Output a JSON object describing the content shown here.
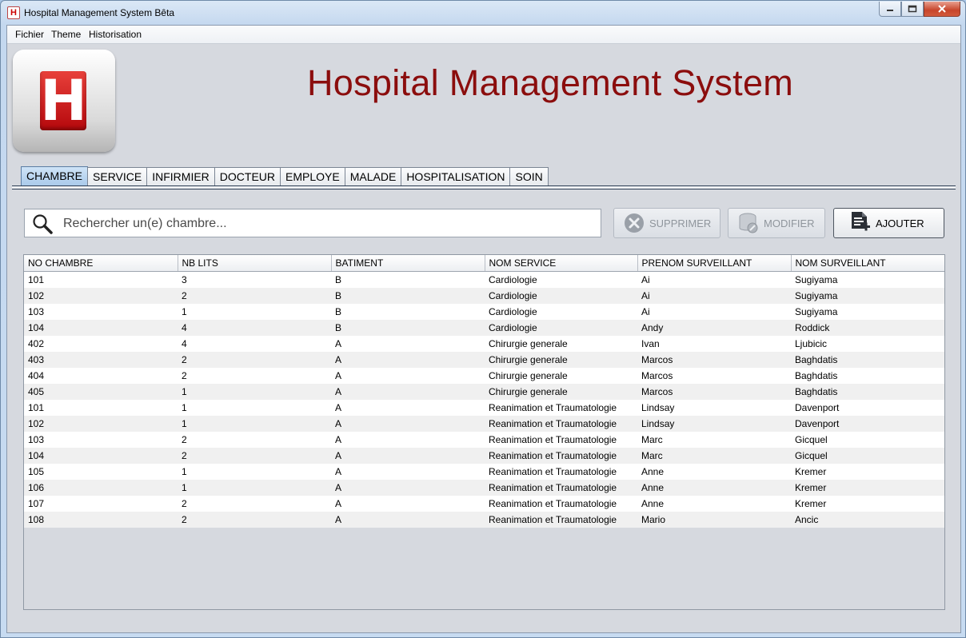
{
  "window": {
    "title": "Hospital Management System Bêta",
    "app_icon_letter": "H"
  },
  "menu": {
    "items": [
      "Fichier",
      "Theme",
      "Historisation"
    ]
  },
  "logo": {
    "letter": "H"
  },
  "header": {
    "title": "Hospital Management System",
    "title_color": "#8b0d0d"
  },
  "tabs": [
    "CHAMBRE",
    "SERVICE",
    "INFIRMIER",
    "DOCTEUR",
    "EMPLOYE",
    "MALADE",
    "HOSPITALISATION",
    "SOIN"
  ],
  "active_tab": "CHAMBRE",
  "search": {
    "placeholder": "Rechercher un(e) chambre...",
    "value": ""
  },
  "actions": {
    "delete_label": "SUPPRIMER",
    "edit_label": "MODIFIER",
    "add_label": "AJOUTER",
    "delete_enabled": false,
    "edit_enabled": false
  },
  "table": {
    "columns": [
      "NO CHAMBRE",
      "NB LITS",
      "BATIMENT",
      "NOM SERVICE",
      "PRENOM SURVEILLANT",
      "NOM SURVEILLANT"
    ],
    "rows": [
      [
        "101",
        "3",
        "B",
        "Cardiologie",
        "Ai",
        "Sugiyama"
      ],
      [
        "102",
        "2",
        "B",
        "Cardiologie",
        "Ai",
        "Sugiyama"
      ],
      [
        "103",
        "1",
        "B",
        "Cardiologie",
        "Ai",
        "Sugiyama"
      ],
      [
        "104",
        "4",
        "B",
        "Cardiologie",
        "Andy",
        "Roddick"
      ],
      [
        "402",
        "4",
        "A",
        "Chirurgie generale",
        "Ivan",
        "Ljubicic"
      ],
      [
        "403",
        "2",
        "A",
        "Chirurgie generale",
        "Marcos",
        "Baghdatis"
      ],
      [
        "404",
        "2",
        "A",
        "Chirurgie generale",
        "Marcos",
        "Baghdatis"
      ],
      [
        "405",
        "1",
        "A",
        "Chirurgie generale",
        "Marcos",
        "Baghdatis"
      ],
      [
        "101",
        "1",
        "A",
        "Reanimation et Traumatologie",
        "Lindsay",
        "Davenport"
      ],
      [
        "102",
        "1",
        "A",
        "Reanimation et Traumatologie",
        "Lindsay",
        "Davenport"
      ],
      [
        "103",
        "2",
        "A",
        "Reanimation et Traumatologie",
        "Marc",
        "Gicquel"
      ],
      [
        "104",
        "2",
        "A",
        "Reanimation et Traumatologie",
        "Marc",
        "Gicquel"
      ],
      [
        "105",
        "1",
        "A",
        "Reanimation et Traumatologie",
        "Anne",
        "Kremer"
      ],
      [
        "106",
        "1",
        "A",
        "Reanimation et Traumatologie",
        "Anne",
        "Kremer"
      ],
      [
        "107",
        "2",
        "A",
        "Reanimation et Traumatologie",
        "Anne",
        "Kremer"
      ],
      [
        "108",
        "2",
        "A",
        "Reanimation et Traumatologie",
        "Mario",
        "Ancic"
      ]
    ]
  },
  "icons": {
    "search": "magnifier-icon",
    "delete": "delete-x-icon",
    "edit": "edit-database-icon",
    "add": "add-document-icon"
  }
}
